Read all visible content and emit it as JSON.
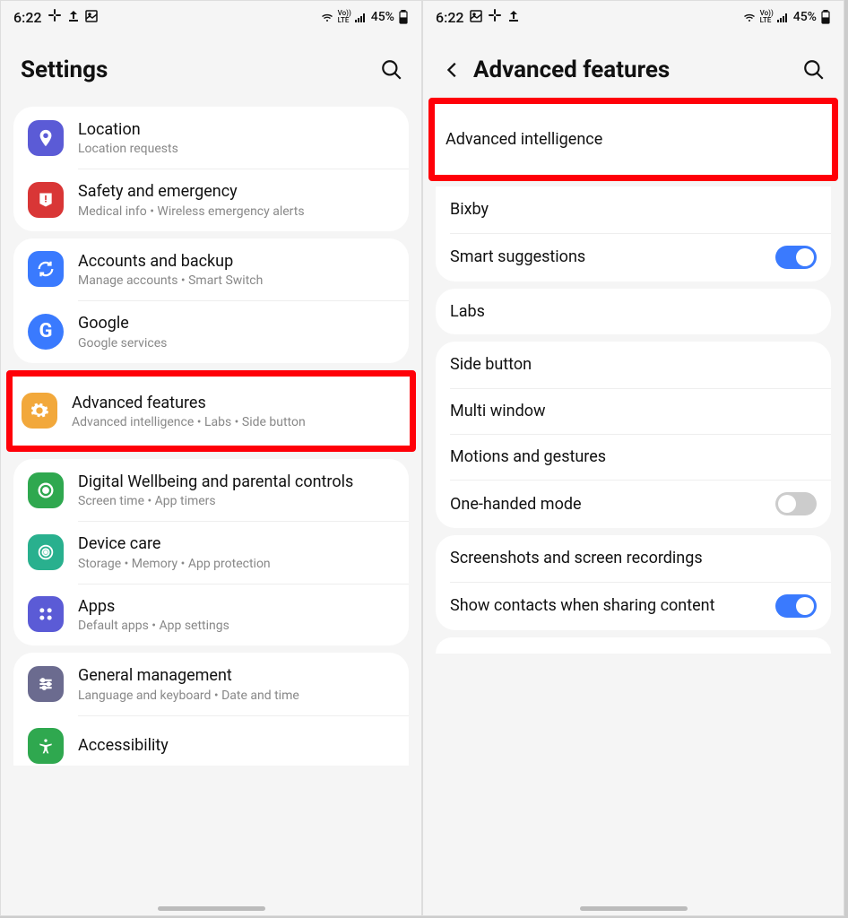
{
  "status": {
    "time": "6:22",
    "battery": "45%",
    "volte": "Vo))\nLTE"
  },
  "left": {
    "header": "Settings",
    "groups": [
      {
        "rows": [
          {
            "id": "location",
            "title": "Location",
            "sub": "Location requests",
            "iconBg": "#5b5bd6",
            "icon": "location"
          },
          {
            "id": "safety",
            "title": "Safety and emergency",
            "sub": "Medical info  •  Wireless emergency alerts",
            "iconBg": "#d93636",
            "icon": "alert"
          }
        ]
      },
      {
        "rows": [
          {
            "id": "accounts",
            "title": "Accounts and backup",
            "sub": "Manage accounts  •  Smart Switch",
            "iconBg": "#3a7afe",
            "icon": "sync"
          },
          {
            "id": "google",
            "title": "Google",
            "sub": "Google services",
            "iconBg": "#3a7afe",
            "icon": "google"
          }
        ]
      },
      {
        "rows": [
          {
            "id": "advanced",
            "title": "Advanced features",
            "sub": "Advanced intelligence  •  Labs  •  Side button",
            "iconBg": "#f2a83b",
            "icon": "gear",
            "highlight": true
          }
        ]
      },
      {
        "rows": [
          {
            "id": "wellbeing",
            "title": "Digital Wellbeing and parental controls",
            "sub": "Screen time  •  App timers",
            "iconBg": "#2fa84f",
            "icon": "wellbeing"
          },
          {
            "id": "devicecare",
            "title": "Device care",
            "sub": "Storage  •  Memory  •  App protection",
            "iconBg": "#29b08e",
            "icon": "devicecare"
          },
          {
            "id": "apps",
            "title": "Apps",
            "sub": "Default apps  •  App settings",
            "iconBg": "#5b5bd6",
            "icon": "apps"
          }
        ]
      },
      {
        "rows": [
          {
            "id": "general",
            "title": "General management",
            "sub": "Language and keyboard  •  Date and time",
            "iconBg": "#6b6b8f",
            "icon": "sliders"
          },
          {
            "id": "accessibility",
            "title": "Accessibility",
            "sub": "",
            "iconBg": "#2fa84f",
            "icon": "accessibility"
          }
        ]
      }
    ]
  },
  "right": {
    "header": "Advanced features",
    "groups": [
      {
        "rows": [
          {
            "id": "ai",
            "title": "Advanced intelligence",
            "highlight": true
          },
          {
            "id": "bixby",
            "title": "Bixby"
          },
          {
            "id": "smartsugg",
            "title": "Smart suggestions",
            "toggle": "on"
          }
        ]
      },
      {
        "rows": [
          {
            "id": "labs",
            "title": "Labs"
          }
        ]
      },
      {
        "rows": [
          {
            "id": "sidebutton",
            "title": "Side button"
          },
          {
            "id": "multiwindow",
            "title": "Multi window"
          },
          {
            "id": "motions",
            "title": "Motions and gestures"
          },
          {
            "id": "onehand",
            "title": "One-handed mode",
            "toggle": "off"
          }
        ]
      },
      {
        "rows": [
          {
            "id": "screenshots",
            "title": "Screenshots and screen recordings"
          },
          {
            "id": "contacts",
            "title": "Show contacts when sharing content",
            "toggle": "on"
          }
        ]
      }
    ]
  }
}
